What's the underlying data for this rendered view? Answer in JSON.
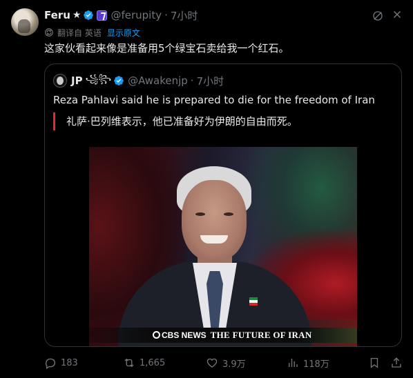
{
  "author": {
    "name": "Feru",
    "star": "★",
    "handle": "@ferupity",
    "separator": "·",
    "time": "7小时"
  },
  "translation": {
    "label": "翻译自 英语",
    "show_original": "显示原文"
  },
  "post_text": "这家伙看起来像是准备用5个绿宝石卖给我一个红石。",
  "quoted": {
    "name": "JP",
    "symbols": "꧁꧂",
    "handle": "@Awakenjp",
    "separator": "·",
    "time": "7小时",
    "text": "Reza Pahlavi said he is prepared to die for the freedom of Iran",
    "translation": "礼萨·巴列维表示，他已准备好为伊朗的自由而死。",
    "media_caption": {
      "network": "CBS NEWS",
      "title": "THE FUTURE OF IRAN"
    }
  },
  "actions": {
    "replies": "183",
    "reposts": "1,665",
    "likes": "3.9万",
    "views": "118万"
  },
  "colors": {
    "background": "#000000",
    "text": "#e7e9ea",
    "muted": "#71767b",
    "accent": "#1d9bf0",
    "quote_border": "#f4212e"
  },
  "icons": [
    "verified-badge-icon",
    "affiliate-badge-icon",
    "grok-icon",
    "more-icon",
    "translate-icon",
    "reply-icon",
    "repost-icon",
    "like-icon",
    "views-icon",
    "bookmark-icon",
    "share-icon"
  ]
}
